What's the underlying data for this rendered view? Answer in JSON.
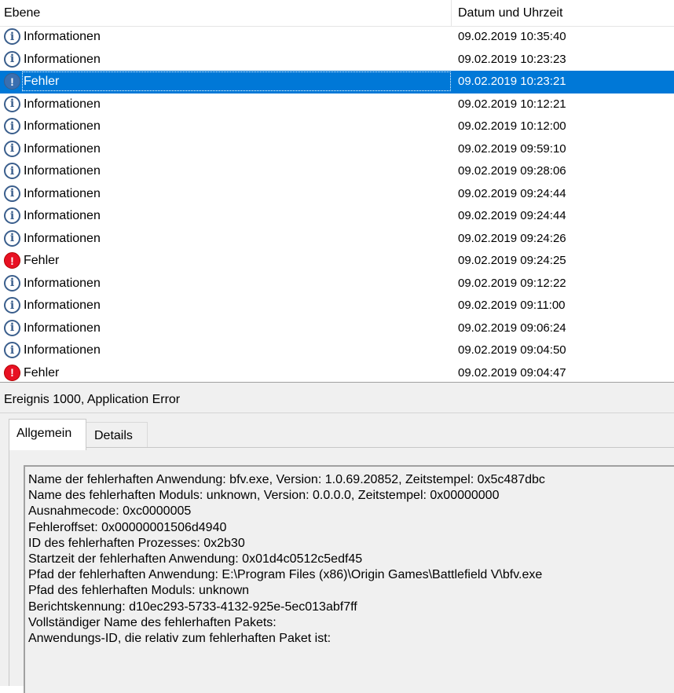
{
  "list": {
    "columns": {
      "level": "Ebene",
      "date": "Datum und Uhrzeit"
    },
    "rows": [
      {
        "level": "Informationen",
        "date": "09.02.2019 10:35:40",
        "type": "info"
      },
      {
        "level": "Informationen",
        "date": "09.02.2019 10:23:23",
        "type": "info"
      },
      {
        "level": "Fehler",
        "date": "09.02.2019 10:23:21",
        "type": "error",
        "selected": true
      },
      {
        "level": "Informationen",
        "date": "09.02.2019 10:12:21",
        "type": "info"
      },
      {
        "level": "Informationen",
        "date": "09.02.2019 10:12:00",
        "type": "info"
      },
      {
        "level": "Informationen",
        "date": "09.02.2019 09:59:10",
        "type": "info"
      },
      {
        "level": "Informationen",
        "date": "09.02.2019 09:28:06",
        "type": "info"
      },
      {
        "level": "Informationen",
        "date": "09.02.2019 09:24:44",
        "type": "info"
      },
      {
        "level": "Informationen",
        "date": "09.02.2019 09:24:44",
        "type": "info"
      },
      {
        "level": "Informationen",
        "date": "09.02.2019 09:24:26",
        "type": "info"
      },
      {
        "level": "Fehler",
        "date": "09.02.2019 09:24:25",
        "type": "error"
      },
      {
        "level": "Informationen",
        "date": "09.02.2019 09:12:22",
        "type": "info"
      },
      {
        "level": "Informationen",
        "date": "09.02.2019 09:11:00",
        "type": "info"
      },
      {
        "level": "Informationen",
        "date": "09.02.2019 09:06:24",
        "type": "info"
      },
      {
        "level": "Informationen",
        "date": "09.02.2019 09:04:50",
        "type": "info"
      },
      {
        "level": "Fehler",
        "date": "09.02.2019 09:04:47",
        "type": "error"
      }
    ]
  },
  "detail": {
    "title": "Ereignis 1000, Application Error",
    "tabs": {
      "general": "Allgemein",
      "details": "Details"
    },
    "message_lines": [
      "Name der fehlerhaften Anwendung: bfv.exe, Version: 1.0.69.20852, Zeitstempel: 0x5c487dbc",
      "Name des fehlerhaften Moduls: unknown, Version: 0.0.0.0, Zeitstempel: 0x00000000",
      "Ausnahmecode: 0xc0000005",
      "Fehleroffset: 0x00000001506d4940",
      "ID des fehlerhaften Prozesses: 0x2b30",
      "Startzeit der fehlerhaften Anwendung: 0x01d4c0512c5edf45",
      "Pfad der fehlerhaften Anwendung: E:\\Program Files (x86)\\Origin Games\\Battlefield V\\bfv.exe",
      "Pfad des fehlerhaften Moduls: unknown",
      "Berichtskennung: d10ec293-5733-4132-925e-5ec013abf7ff",
      "Vollständiger Name des fehlerhaften Pakets:",
      "Anwendungs-ID, die relativ zum fehlerhaften Paket ist:"
    ]
  },
  "icons": {
    "info": "info-icon",
    "error": "error-icon"
  },
  "colors": {
    "selection": "#0078d7",
    "error": "#e81123",
    "info": "#3a5e8c"
  }
}
